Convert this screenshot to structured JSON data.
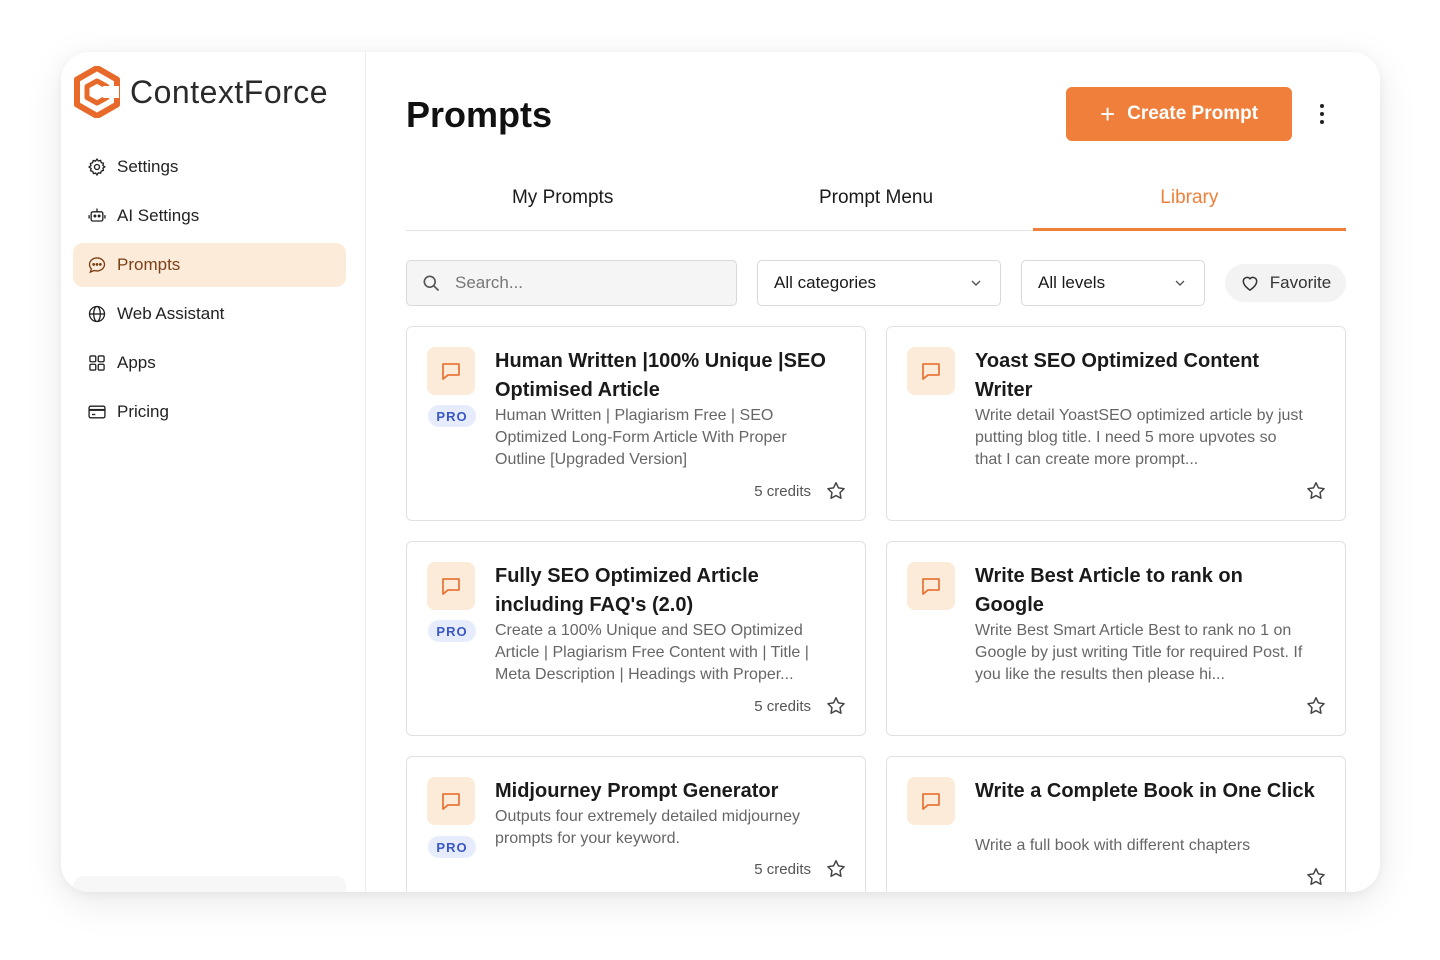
{
  "app": {
    "logo_bold": "Context",
    "logo_light": "Force",
    "brand_color": "#ef7f3a",
    "logo_color": "#e86a2a"
  },
  "sidebar": {
    "items": [
      {
        "label": "Settings",
        "icon": "gear-icon",
        "active": false
      },
      {
        "label": "AI Settings",
        "icon": "robot-icon",
        "active": false
      },
      {
        "label": "Prompts",
        "icon": "chat-bubble-icon",
        "active": true
      },
      {
        "label": "Web Assistant",
        "icon": "globe-icon",
        "active": false
      },
      {
        "label": "Apps",
        "icon": "grid-icon",
        "active": false
      },
      {
        "label": "Pricing",
        "icon": "credit-card-icon",
        "active": false
      }
    ]
  },
  "header": {
    "title": "Prompts",
    "create_label": "Create Prompt",
    "more_icon": "more-vertical-icon"
  },
  "tabs": [
    {
      "label": "My Prompts",
      "active": false
    },
    {
      "label": "Prompt Menu",
      "active": false
    },
    {
      "label": "Library",
      "active": true
    }
  ],
  "filters": {
    "search_placeholder": "Search...",
    "category": "All categories",
    "level": "All levels",
    "favorite_label": "Favorite"
  },
  "cards": [
    {
      "title": "Human Written |100% Unique |SEO Optimised Article",
      "description": "Human Written | Plagiarism Free | SEO Optimized Long-Form Article With Proper Outline [Upgraded Version]",
      "pro": "PRO",
      "credits": "5 credits"
    },
    {
      "title": "Yoast SEO Optimized Content Writer",
      "description": "Write detail YoastSEO optimized article by just putting blog title. I need 5 more upvotes so that I can create more prompt...",
      "pro": "",
      "credits": ""
    },
    {
      "title": "Fully SEO Optimized Article including FAQ's (2.0)",
      "description": "Create a 100% Unique and SEO Optimized Article | Plagiarism Free Content with | Title | Meta Description | Headings with Proper...",
      "pro": "PRO",
      "credits": "5 credits"
    },
    {
      "title": "Write Best Article to rank on Google",
      "description": "Write Best Smart Article Best to rank no 1 on Google by just writing Title for required Post. If you like the results then please hi...",
      "pro": "",
      "credits": ""
    },
    {
      "title": "Midjourney Prompt Generator",
      "description": "Outputs four extremely detailed midjourney prompts for your keyword.",
      "pro": "PRO",
      "credits": "5 credits"
    },
    {
      "title": "Write a Complete Book in One Click",
      "description": "Write a full book with different chapters",
      "pro": "",
      "credits": ""
    }
  ]
}
